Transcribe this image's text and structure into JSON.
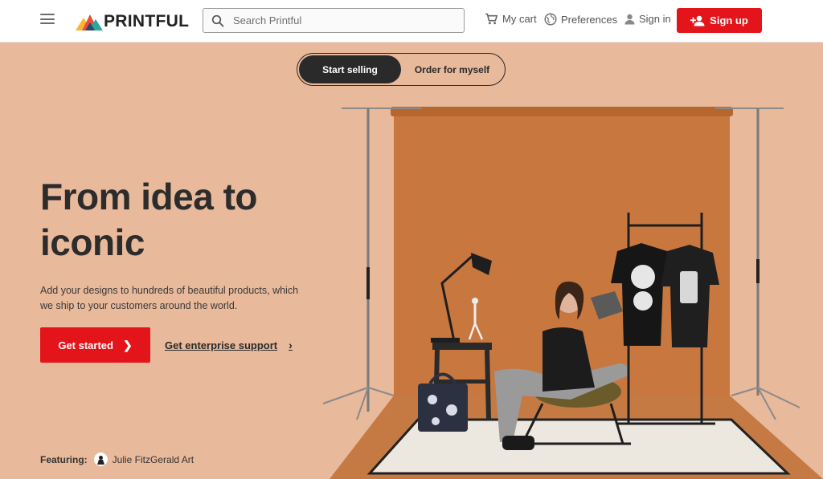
{
  "header": {
    "logo_text": "PRINTFUL",
    "search_placeholder": "Search Printful",
    "nav": {
      "cart_label": "My cart",
      "preferences_label": "Preferences",
      "signin_label": "Sign in",
      "signup_label": "Sign up"
    }
  },
  "hero": {
    "toggle": [
      {
        "label": "Start selling",
        "active": true
      },
      {
        "label": "Order for myself",
        "active": false
      }
    ],
    "headline_line1": "From idea to",
    "headline_line2": "iconic",
    "subtext": "Add your designs to hundreds of beautiful products, which we ship to your customers around the world.",
    "cta_label": "Get started",
    "enterprise_label": "Get enterprise support",
    "featuring_label": "Featuring:",
    "featuring_artist": "Julie FitzGerald Art"
  },
  "colors": {
    "brand_red": "#e4141b",
    "hero_bg": "#e8b99a",
    "backdrop": "#c8773f",
    "dark": "#2a2a2a"
  }
}
